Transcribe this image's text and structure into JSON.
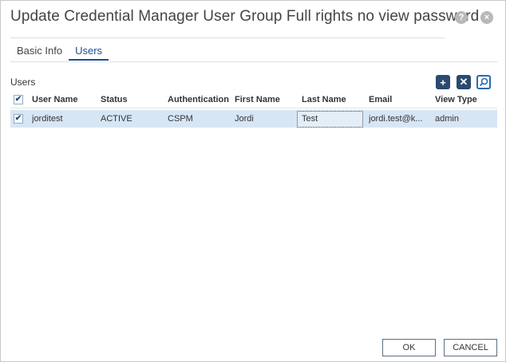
{
  "dialog": {
    "title": "Update Credential Manager User Group Full rights no view password",
    "help_icon": "?",
    "close_icon": "×"
  },
  "tabs": [
    {
      "label": "Basic Info",
      "active": false
    },
    {
      "label": "Users",
      "active": true
    }
  ],
  "users_section": {
    "label": "Users",
    "toolbar": {
      "add_icon": "add-icon",
      "delete_icon": "delete-icon",
      "search_icon": "search-icon"
    }
  },
  "table": {
    "headers": [
      "User Name",
      "Status",
      "Authentication",
      "First Name",
      "Last Name",
      "Email",
      "View Type"
    ],
    "header_checked": true,
    "rows": [
      {
        "checked": true,
        "user_name": "jorditest",
        "status": "ACTIVE",
        "authentication": "CSPM",
        "first_name": "Jordi",
        "last_name": "Test",
        "email": "jordi.test@k...",
        "view_type": "admin"
      }
    ]
  },
  "footer": {
    "ok_label": "OK",
    "cancel_label": "CANCEL"
  },
  "colors": {
    "accent": "#1a4f8a",
    "selected_row": "#d7e6f5",
    "toolbar_button": "#2a4a6e"
  }
}
